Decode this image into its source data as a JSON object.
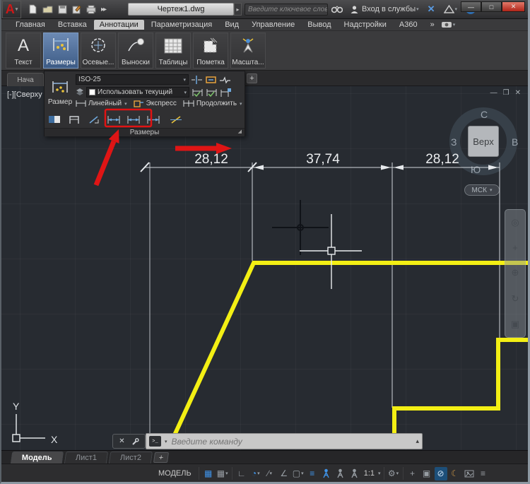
{
  "titlebar": {
    "filename": "Чертеж1.dwg",
    "search_placeholder": "Введите ключевое слово/фразу",
    "signin_label": "Вход в службы"
  },
  "menu": {
    "tabs": [
      "Главная",
      "Вставка",
      "Аннотации",
      "Параметризация",
      "Вид",
      "Управление",
      "Вывод",
      "Надстройки",
      "A360"
    ],
    "active": "Аннотации",
    "overflow": "»"
  },
  "ribbon_panels": [
    {
      "label": "Текст"
    },
    {
      "label": "Размеры"
    },
    {
      "label": "Осевые..."
    },
    {
      "label": "Выноски"
    },
    {
      "label": "Таблицы"
    },
    {
      "label": "Пометка"
    },
    {
      "label": "Масшта..."
    }
  ],
  "file_tab_bar": {
    "start_tab": "Нача",
    "new_tab": "+"
  },
  "dim_panel": {
    "size_button": "Размер",
    "style_value": "ISO-25",
    "layer_value": "Использовать текущий",
    "linear": "Линейный",
    "express": "Экспресс",
    "continue": "Продолжить",
    "title": "Размеры"
  },
  "viewport": {
    "label": "[-][Сверху"
  },
  "viewcube": {
    "north": "С",
    "west": "З",
    "east": "В",
    "south": "Ю",
    "face": "Верх"
  },
  "ucs_badge": "МСК",
  "dimensions": {
    "values": [
      "28,12",
      "37,74",
      "28,12"
    ]
  },
  "ucs_icon": {
    "x": "X",
    "y": "Y"
  },
  "command_line": {
    "placeholder": "Введите команду"
  },
  "layout_tabs": {
    "items": [
      "Модель",
      "Лист1",
      "Лист2"
    ],
    "active": "Модель",
    "add": "+"
  },
  "status_bar": {
    "model": "МОДЕЛЬ",
    "scale": "1:1"
  },
  "colors": {
    "accent_blue": "#3f93e8",
    "canvas_bg": "#272b31",
    "object_yellow": "#f3ef14",
    "annotation_red": "#e01313",
    "dim_white": "#e6e9ec"
  }
}
